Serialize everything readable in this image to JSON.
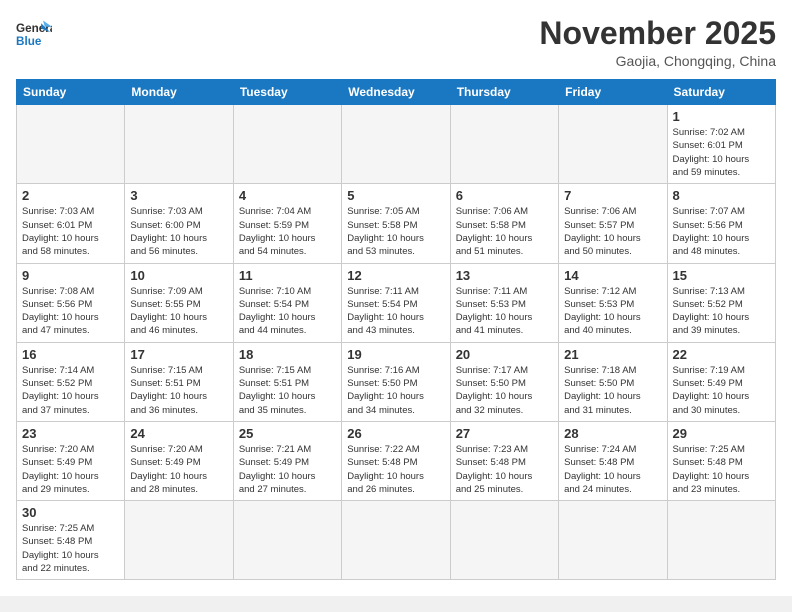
{
  "header": {
    "logo_general": "General",
    "logo_blue": "Blue",
    "month_title": "November 2025",
    "subtitle": "Gaojia, Chongqing, China"
  },
  "weekdays": [
    "Sunday",
    "Monday",
    "Tuesday",
    "Wednesday",
    "Thursday",
    "Friday",
    "Saturday"
  ],
  "weeks": [
    [
      {
        "day": "",
        "info": ""
      },
      {
        "day": "",
        "info": ""
      },
      {
        "day": "",
        "info": ""
      },
      {
        "day": "",
        "info": ""
      },
      {
        "day": "",
        "info": ""
      },
      {
        "day": "",
        "info": ""
      },
      {
        "day": "1",
        "info": "Sunrise: 7:02 AM\nSunset: 6:01 PM\nDaylight: 10 hours\nand 59 minutes."
      }
    ],
    [
      {
        "day": "2",
        "info": "Sunrise: 7:03 AM\nSunset: 6:01 PM\nDaylight: 10 hours\nand 58 minutes."
      },
      {
        "day": "3",
        "info": "Sunrise: 7:03 AM\nSunset: 6:00 PM\nDaylight: 10 hours\nand 56 minutes."
      },
      {
        "day": "4",
        "info": "Sunrise: 7:04 AM\nSunset: 5:59 PM\nDaylight: 10 hours\nand 54 minutes."
      },
      {
        "day": "5",
        "info": "Sunrise: 7:05 AM\nSunset: 5:58 PM\nDaylight: 10 hours\nand 53 minutes."
      },
      {
        "day": "6",
        "info": "Sunrise: 7:06 AM\nSunset: 5:58 PM\nDaylight: 10 hours\nand 51 minutes."
      },
      {
        "day": "7",
        "info": "Sunrise: 7:06 AM\nSunset: 5:57 PM\nDaylight: 10 hours\nand 50 minutes."
      },
      {
        "day": "8",
        "info": "Sunrise: 7:07 AM\nSunset: 5:56 PM\nDaylight: 10 hours\nand 48 minutes."
      }
    ],
    [
      {
        "day": "9",
        "info": "Sunrise: 7:08 AM\nSunset: 5:56 PM\nDaylight: 10 hours\nand 47 minutes."
      },
      {
        "day": "10",
        "info": "Sunrise: 7:09 AM\nSunset: 5:55 PM\nDaylight: 10 hours\nand 46 minutes."
      },
      {
        "day": "11",
        "info": "Sunrise: 7:10 AM\nSunset: 5:54 PM\nDaylight: 10 hours\nand 44 minutes."
      },
      {
        "day": "12",
        "info": "Sunrise: 7:11 AM\nSunset: 5:54 PM\nDaylight: 10 hours\nand 43 minutes."
      },
      {
        "day": "13",
        "info": "Sunrise: 7:11 AM\nSunset: 5:53 PM\nDaylight: 10 hours\nand 41 minutes."
      },
      {
        "day": "14",
        "info": "Sunrise: 7:12 AM\nSunset: 5:53 PM\nDaylight: 10 hours\nand 40 minutes."
      },
      {
        "day": "15",
        "info": "Sunrise: 7:13 AM\nSunset: 5:52 PM\nDaylight: 10 hours\nand 39 minutes."
      }
    ],
    [
      {
        "day": "16",
        "info": "Sunrise: 7:14 AM\nSunset: 5:52 PM\nDaylight: 10 hours\nand 37 minutes."
      },
      {
        "day": "17",
        "info": "Sunrise: 7:15 AM\nSunset: 5:51 PM\nDaylight: 10 hours\nand 36 minutes."
      },
      {
        "day": "18",
        "info": "Sunrise: 7:15 AM\nSunset: 5:51 PM\nDaylight: 10 hours\nand 35 minutes."
      },
      {
        "day": "19",
        "info": "Sunrise: 7:16 AM\nSunset: 5:50 PM\nDaylight: 10 hours\nand 34 minutes."
      },
      {
        "day": "20",
        "info": "Sunrise: 7:17 AM\nSunset: 5:50 PM\nDaylight: 10 hours\nand 32 minutes."
      },
      {
        "day": "21",
        "info": "Sunrise: 7:18 AM\nSunset: 5:50 PM\nDaylight: 10 hours\nand 31 minutes."
      },
      {
        "day": "22",
        "info": "Sunrise: 7:19 AM\nSunset: 5:49 PM\nDaylight: 10 hours\nand 30 minutes."
      }
    ],
    [
      {
        "day": "23",
        "info": "Sunrise: 7:20 AM\nSunset: 5:49 PM\nDaylight: 10 hours\nand 29 minutes."
      },
      {
        "day": "24",
        "info": "Sunrise: 7:20 AM\nSunset: 5:49 PM\nDaylight: 10 hours\nand 28 minutes."
      },
      {
        "day": "25",
        "info": "Sunrise: 7:21 AM\nSunset: 5:49 PM\nDaylight: 10 hours\nand 27 minutes."
      },
      {
        "day": "26",
        "info": "Sunrise: 7:22 AM\nSunset: 5:48 PM\nDaylight: 10 hours\nand 26 minutes."
      },
      {
        "day": "27",
        "info": "Sunrise: 7:23 AM\nSunset: 5:48 PM\nDaylight: 10 hours\nand 25 minutes."
      },
      {
        "day": "28",
        "info": "Sunrise: 7:24 AM\nSunset: 5:48 PM\nDaylight: 10 hours\nand 24 minutes."
      },
      {
        "day": "29",
        "info": "Sunrise: 7:25 AM\nSunset: 5:48 PM\nDaylight: 10 hours\nand 23 minutes."
      }
    ],
    [
      {
        "day": "30",
        "info": "Sunrise: 7:25 AM\nSunset: 5:48 PM\nDaylight: 10 hours\nand 22 minutes."
      },
      {
        "day": "",
        "info": ""
      },
      {
        "day": "",
        "info": ""
      },
      {
        "day": "",
        "info": ""
      },
      {
        "day": "",
        "info": ""
      },
      {
        "day": "",
        "info": ""
      },
      {
        "day": "",
        "info": ""
      }
    ]
  ]
}
